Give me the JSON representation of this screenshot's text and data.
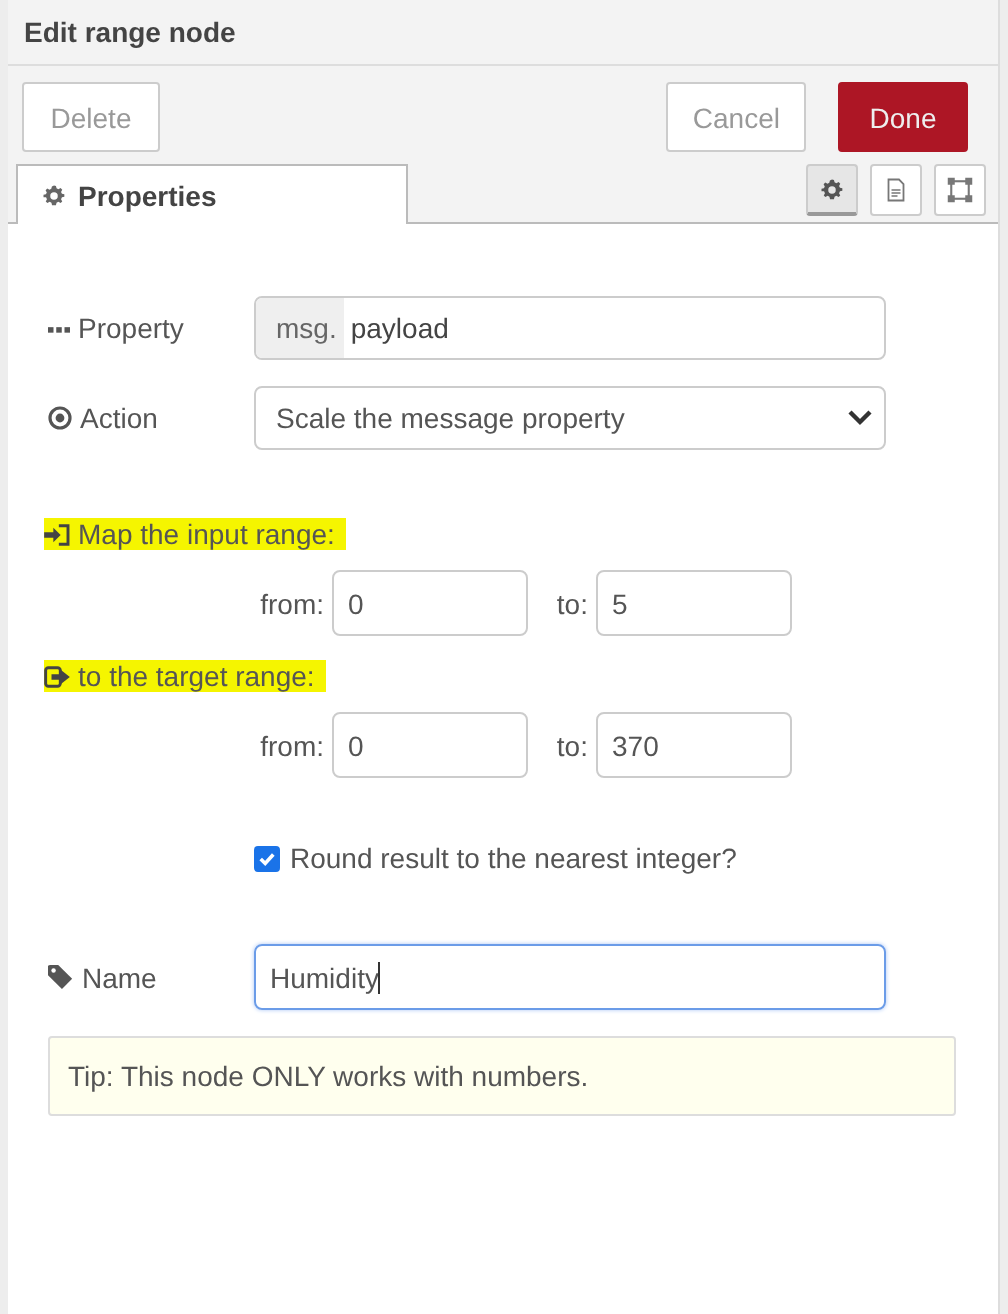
{
  "window": {
    "title": "Edit range node"
  },
  "buttons": [
    {
      "label": "Delete",
      "kind": "plain"
    },
    {
      "label": "Cancel",
      "kind": "plain"
    },
    {
      "label": "Done",
      "kind": "primary"
    }
  ],
  "tabs": [
    {
      "label": "Properties",
      "selected": true
    }
  ],
  "tab_icons": [
    {
      "kind": "gear",
      "selected": true
    },
    {
      "kind": "document",
      "selected": false
    },
    {
      "kind": "frame",
      "selected": false
    }
  ],
  "property": {
    "label": "Property",
    "prefix": "msg.",
    "value": "payload"
  },
  "action": {
    "label": "Action",
    "value": "Scale the message property"
  },
  "ranges": [
    {
      "heading": "Map the input range:",
      "highlighted": true,
      "kind": "input",
      "from_label": "from:",
      "from": "0",
      "to_label": "to:",
      "to": "5"
    },
    {
      "heading": "to the target range:",
      "highlighted": true,
      "kind": "target",
      "from_label": "from:",
      "from": "0",
      "to_label": "to:",
      "to": "370"
    }
  ],
  "round": {
    "label": "Round result to the nearest integer?",
    "checked": true
  },
  "name": {
    "label": "Name",
    "value": "Humidity",
    "focused": true
  },
  "tip": "Tip: This node ONLY works with numbers."
}
